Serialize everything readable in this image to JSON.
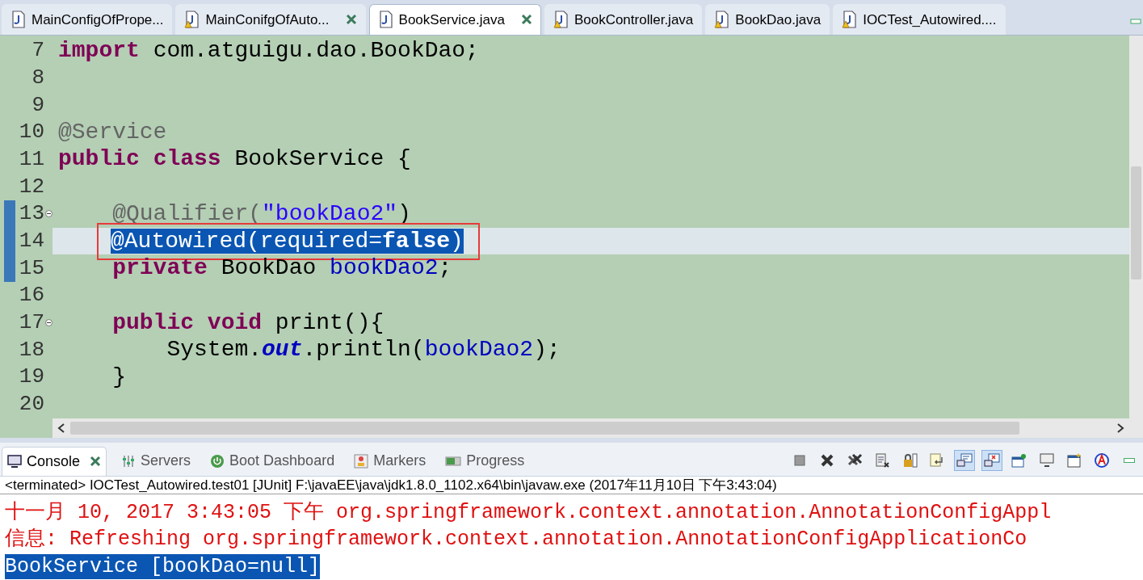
{
  "editor_tabs": [
    {
      "label": "MainConfigOfPrope...",
      "selected": false,
      "warning": false,
      "close_button": false
    },
    {
      "label": "MainConifgOfAuto...",
      "selected": false,
      "warning": true,
      "close_button": true
    },
    {
      "label": "BookService.java",
      "selected": true,
      "warning": false,
      "close_button": true
    },
    {
      "label": "BookController.java",
      "selected": false,
      "warning": true,
      "close_button": false
    },
    {
      "label": "BookDao.java",
      "selected": false,
      "warning": true,
      "close_button": false
    },
    {
      "label": "IOCTest_Autowired....",
      "selected": false,
      "warning": true,
      "close_button": false
    }
  ],
  "editor": {
    "lines": [
      {
        "number": "7",
        "current": false,
        "changed": false,
        "fold": false,
        "boxed": false,
        "segments": [
          {
            "kind": "keyword",
            "text": "import"
          },
          {
            "kind": "plain",
            "text": " com.atguigu.dao.BookDao;"
          }
        ]
      },
      {
        "number": "8",
        "current": false,
        "changed": false,
        "fold": false,
        "boxed": false
      },
      {
        "number": "9",
        "current": false,
        "changed": false,
        "fold": false,
        "boxed": false
      },
      {
        "number": "10",
        "current": false,
        "changed": false,
        "fold": false,
        "boxed": false,
        "segments": [
          {
            "kind": "annotation",
            "text": "@Service"
          }
        ]
      },
      {
        "number": "11",
        "current": false,
        "changed": false,
        "fold": false,
        "boxed": false,
        "segments": [
          {
            "kind": "keyword",
            "text": "public "
          },
          {
            "kind": "keyword",
            "text": "class"
          },
          {
            "kind": "plain",
            "text": " BookService {"
          }
        ]
      },
      {
        "number": "12",
        "current": false,
        "changed": false,
        "fold": false,
        "boxed": false
      },
      {
        "number": "13",
        "current": false,
        "changed": true,
        "fold": true,
        "boxed": false,
        "segments": [
          {
            "kind": "annotation",
            "text": "    @Qualifier("
          },
          {
            "kind": "string",
            "text": "\"bookDao2\""
          },
          {
            "kind": "plain",
            "text": ")"
          }
        ]
      },
      {
        "number": "14",
        "current": true,
        "changed": true,
        "fold": false,
        "boxed": true,
        "segments": [
          {
            "kind": "selected",
            "text": "@Autowired(required="
          },
          {
            "kind": "selected_bold",
            "text": "false"
          },
          {
            "kind": "selected",
            "text": ")"
          }
        ]
      },
      {
        "number": "15",
        "current": false,
        "changed": true,
        "fold": false,
        "boxed": false,
        "segments": [
          {
            "kind": "keyword",
            "text": "    private"
          },
          {
            "kind": "plain",
            "text": " BookDao "
          },
          {
            "kind": "field",
            "text": "bookDao2"
          },
          {
            "kind": "plain",
            "text": ";"
          }
        ]
      },
      {
        "number": "16",
        "current": false,
        "changed": false,
        "fold": false,
        "boxed": false
      },
      {
        "number": "17",
        "current": false,
        "changed": false,
        "fold": true,
        "boxed": false,
        "segments": [
          {
            "kind": "keyword",
            "text": "    public "
          },
          {
            "kind": "keyword",
            "text": "void"
          },
          {
            "kind": "plain",
            "text": " print(){"
          }
        ]
      },
      {
        "number": "18",
        "current": false,
        "changed": false,
        "fold": false,
        "boxed": false,
        "segments": [
          {
            "kind": "plain",
            "text": "        System."
          },
          {
            "kind": "static",
            "text": "out"
          },
          {
            "kind": "plain",
            "text": ".println("
          },
          {
            "kind": "field",
            "text": "bookDao2"
          },
          {
            "kind": "plain",
            "text": ");"
          }
        ]
      },
      {
        "number": "19",
        "current": false,
        "changed": false,
        "fold": false,
        "boxed": false,
        "segments": [
          {
            "kind": "plain",
            "text": "    }"
          }
        ]
      },
      {
        "number": "20",
        "current": false,
        "changed": false,
        "fold": false,
        "boxed": false
      }
    ]
  },
  "console": {
    "tabs": [
      {
        "label": "Console",
        "selected": true,
        "kind": "console",
        "close_button": true
      },
      {
        "label": "Servers",
        "selected": false,
        "kind": "servers",
        "close_button": false
      },
      {
        "label": "Boot Dashboard",
        "selected": false,
        "kind": "dashboard",
        "close_button": false
      },
      {
        "label": "Markers",
        "selected": false,
        "kind": "markers",
        "close_button": false
      },
      {
        "label": "Progress",
        "selected": false,
        "kind": "progress",
        "close_button": false
      }
    ],
    "show_on_stdout": true,
    "show_on_stderr": true,
    "header": "<terminated> IOCTest_Autowired.test01 [JUnit] F:\\javaEE\\java\\jdk1.8.0_1102.x64\\bin\\javaw.exe (2017年11月10日 下午3:43:04)",
    "output": [
      {
        "kind": "stderr",
        "selected": false,
        "text": "十一月 10, 2017 3:43:05 下午 org.springframework.context.annotation.AnnotationConfigAppl"
      },
      {
        "kind": "stderr",
        "selected": false,
        "text": "信息: Refreshing org.springframework.context.annotation.AnnotationConfigApplicationCo"
      },
      {
        "kind": "stdout",
        "selected": true,
        "text": "BookService [bookDao=null]"
      }
    ]
  }
}
